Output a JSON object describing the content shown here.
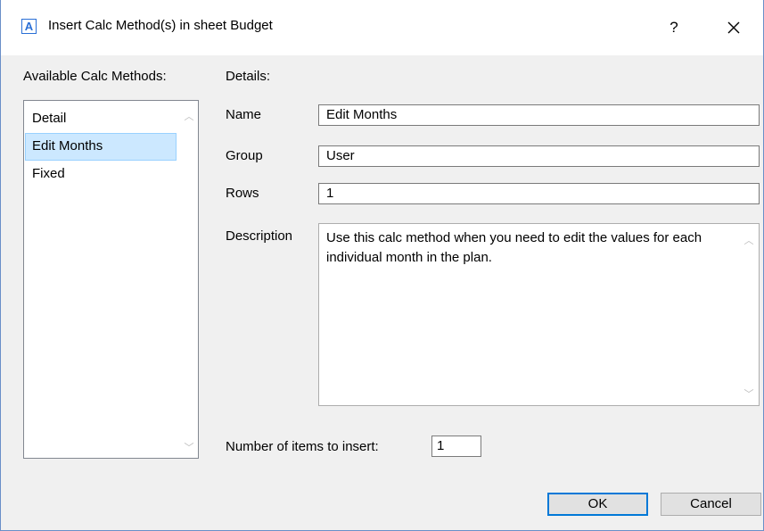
{
  "dialog": {
    "app_icon_glyph": "A",
    "title": "Insert Calc Method(s) in sheet Budget",
    "help_glyph": "?",
    "close_icon": "close-icon"
  },
  "left": {
    "label": "Available Calc Methods:",
    "items": [
      {
        "label": "Detail",
        "selected": false
      },
      {
        "label": "Edit Months",
        "selected": true
      },
      {
        "label": "Fixed",
        "selected": false
      }
    ],
    "scroll_up_glyph": "︿",
    "scroll_down_glyph": "﹀"
  },
  "details": {
    "label": "Details:",
    "name_label": "Name",
    "name_value": "Edit Months",
    "group_label": "Group",
    "group_value": "User",
    "rows_label": "Rows",
    "rows_value": "1",
    "description_label": "Description",
    "description_value": "Use this calc method when you need to edit the values for each individual month in the plan."
  },
  "insert": {
    "label": "Number of items to insert:",
    "value": "1"
  },
  "buttons": {
    "ok": "OK",
    "cancel": "Cancel"
  },
  "colors": {
    "selection": "#cce8ff",
    "accent": "#0078d7"
  }
}
